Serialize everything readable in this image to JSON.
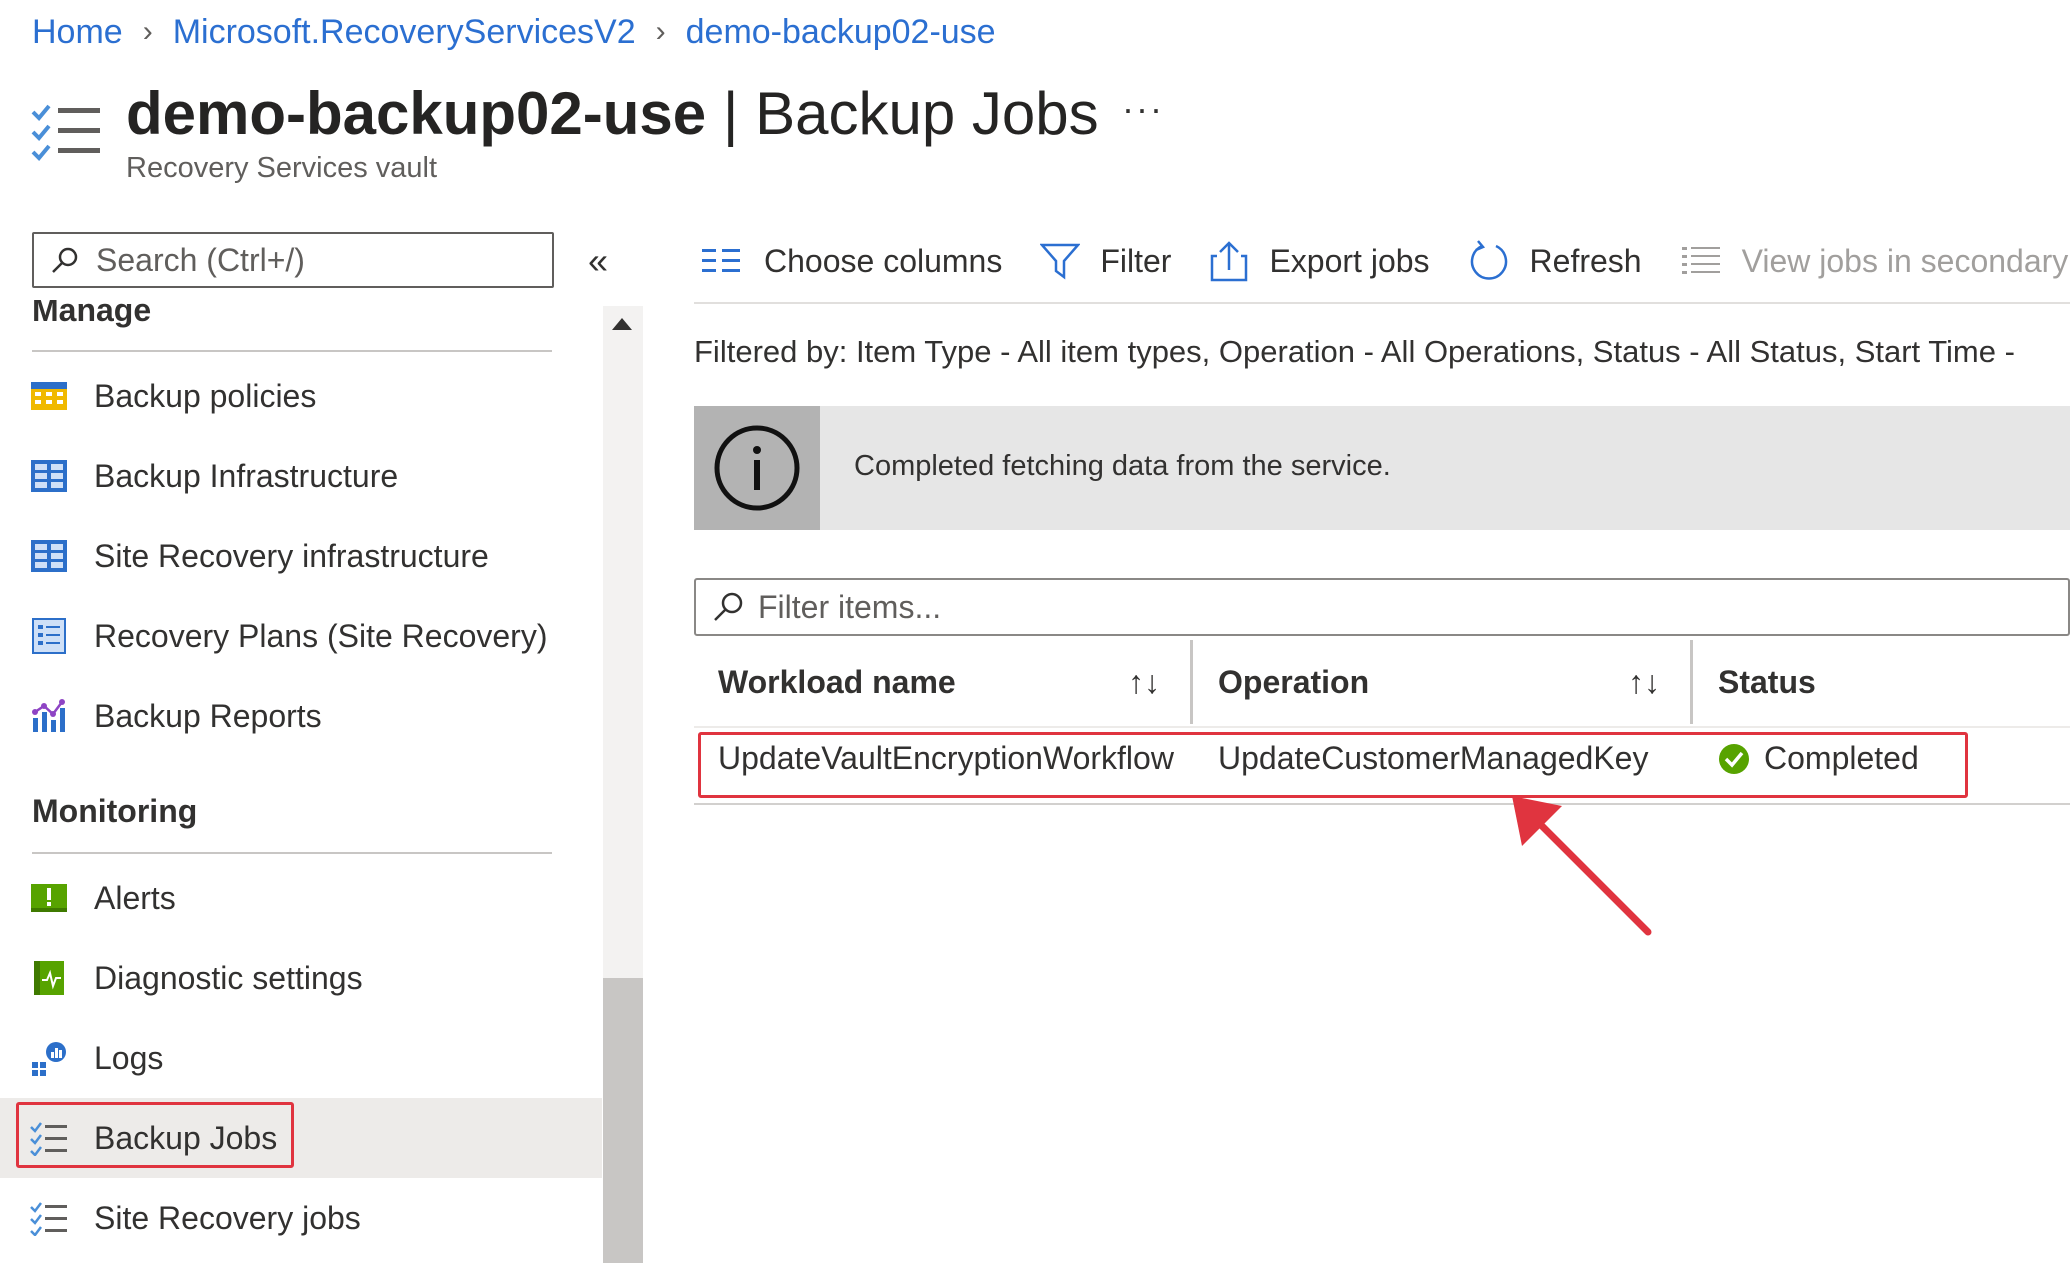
{
  "breadcrumb": {
    "home": "Home",
    "provider": "Microsoft.RecoveryServicesV2",
    "resource": "demo-backup02-use"
  },
  "header": {
    "title_bold": "demo-backup02-use",
    "title_sep": " | ",
    "title_rest": "Backup Jobs",
    "subtitle": "Recovery Services vault",
    "more": "···",
    "icon": "checklist-icon"
  },
  "sidebar": {
    "search_placeholder": "Search (Ctrl+/)",
    "collapse": "«",
    "sections": [
      {
        "title": "Manage",
        "items": [
          {
            "label": "Backup policies",
            "icon": "calendar-grid-icon"
          },
          {
            "label": "Backup Infrastructure",
            "icon": "grid-icon"
          },
          {
            "label": "Site Recovery infrastructure",
            "icon": "grid-icon"
          },
          {
            "label": "Recovery Plans (Site Recovery)",
            "icon": "plan-list-icon"
          },
          {
            "label": "Backup Reports",
            "icon": "chart-icon"
          }
        ]
      },
      {
        "title": "Monitoring",
        "items": [
          {
            "label": "Alerts",
            "icon": "alert-icon"
          },
          {
            "label": "Diagnostic settings",
            "icon": "diagnostic-icon"
          },
          {
            "label": "Logs",
            "icon": "logs-icon"
          },
          {
            "label": "Backup Jobs",
            "icon": "checklist-icon",
            "selected": true
          },
          {
            "label": "Site Recovery jobs",
            "icon": "checklist-icon"
          }
        ]
      }
    ]
  },
  "toolbar": {
    "choose_columns": "Choose columns",
    "filter": "Filter",
    "export": "Export jobs",
    "refresh": "Refresh",
    "view_secondary": "View jobs in secondary"
  },
  "filtered_by": "Filtered by: Item Type - All item types, Operation - All Operations, Status - All Status, Start Time -",
  "banner": {
    "icon": "info-icon",
    "text": "Completed fetching data from the service."
  },
  "grid": {
    "filter_placeholder": "Filter items...",
    "columns": [
      "Workload name",
      "Operation",
      "Status"
    ],
    "sort_glyph": "↑↓",
    "rows": [
      {
        "workload": "UpdateVaultEncryptionWorkflow",
        "operation": "UpdateCustomerManagedKey",
        "status": "Completed"
      }
    ]
  },
  "colors": {
    "link": "#2b6fd1",
    "highlight": "#e0343f",
    "success": "#57a300"
  }
}
